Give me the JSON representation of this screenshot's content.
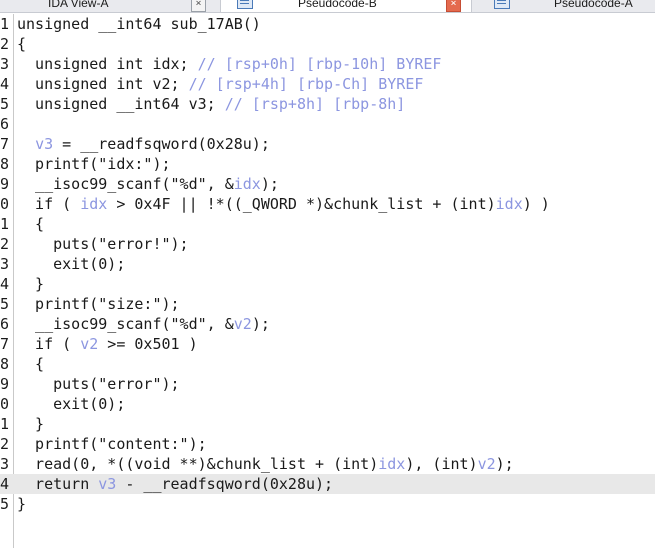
{
  "tabs": [
    {
      "label": "IDA View-A",
      "close": "×"
    },
    {
      "label": "Pseudocode-B",
      "close": "×"
    },
    {
      "label": "Pseudocode-A"
    }
  ],
  "code": [
    {
      "n": "1",
      "parts": [
        [
          "def",
          "unsigned __int64 sub_17AB()"
        ]
      ]
    },
    {
      "n": "2",
      "parts": [
        [
          "def",
          "{"
        ]
      ]
    },
    {
      "n": "3",
      "parts": [
        [
          "def",
          "  unsigned int idx; "
        ],
        [
          "cmt",
          "// [rsp+0h] [rbp-10h] BYREF"
        ]
      ]
    },
    {
      "n": "4",
      "parts": [
        [
          "def",
          "  unsigned int v2; "
        ],
        [
          "cmt",
          "// [rsp+4h] [rbp-Ch] BYREF"
        ]
      ]
    },
    {
      "n": "5",
      "parts": [
        [
          "def",
          "  unsigned __int64 v3; "
        ],
        [
          "cmt",
          "// [rsp+8h] [rbp-8h]"
        ]
      ]
    },
    {
      "n": "6",
      "parts": []
    },
    {
      "n": "7",
      "parts": [
        [
          "def",
          "  "
        ],
        [
          "var",
          "v3"
        ],
        [
          "def",
          " = __readfsqword(0x28u);"
        ]
      ]
    },
    {
      "n": "8",
      "parts": [
        [
          "def",
          "  printf(\"idx:\");"
        ]
      ]
    },
    {
      "n": "9",
      "parts": [
        [
          "def",
          "  __isoc99_scanf(\"%d\", &"
        ],
        [
          "var",
          "idx"
        ],
        [
          "def",
          ");"
        ]
      ]
    },
    {
      "n": "0",
      "parts": [
        [
          "def",
          "  if ( "
        ],
        [
          "var",
          "idx"
        ],
        [
          "def",
          " > 0x4F || !*((_QWORD *)&chunk_list + (int)"
        ],
        [
          "var",
          "idx"
        ],
        [
          "def",
          ") )"
        ]
      ]
    },
    {
      "n": "1",
      "parts": [
        [
          "def",
          "  {"
        ]
      ]
    },
    {
      "n": "2",
      "parts": [
        [
          "def",
          "    puts(\"error!\");"
        ]
      ]
    },
    {
      "n": "3",
      "parts": [
        [
          "def",
          "    exit(0);"
        ]
      ]
    },
    {
      "n": "4",
      "parts": [
        [
          "def",
          "  }"
        ]
      ]
    },
    {
      "n": "5",
      "parts": [
        [
          "def",
          "  printf(\"size:\");"
        ]
      ]
    },
    {
      "n": "6",
      "parts": [
        [
          "def",
          "  __isoc99_scanf(\"%d\", &"
        ],
        [
          "var",
          "v2"
        ],
        [
          "def",
          ");"
        ]
      ]
    },
    {
      "n": "7",
      "parts": [
        [
          "def",
          "  if ( "
        ],
        [
          "var",
          "v2"
        ],
        [
          "def",
          " >= 0x501 )"
        ]
      ]
    },
    {
      "n": "8",
      "parts": [
        [
          "def",
          "  {"
        ]
      ]
    },
    {
      "n": "9",
      "parts": [
        [
          "def",
          "    puts(\"error\");"
        ]
      ]
    },
    {
      "n": "0",
      "parts": [
        [
          "def",
          "    exit(0);"
        ]
      ]
    },
    {
      "n": "1",
      "parts": [
        [
          "def",
          "  }"
        ]
      ]
    },
    {
      "n": "2",
      "parts": [
        [
          "def",
          "  printf(\"content:\");"
        ]
      ]
    },
    {
      "n": "3",
      "parts": [
        [
          "def",
          "  read(0, *((void **)&chunk_list + (int)"
        ],
        [
          "var",
          "idx"
        ],
        [
          "def",
          "), (int)"
        ],
        [
          "var",
          "v2"
        ],
        [
          "def",
          ");"
        ]
      ]
    },
    {
      "n": "4",
      "parts": [
        [
          "def",
          "  return "
        ],
        [
          "var",
          "v3"
        ],
        [
          "def",
          " - __readfsqword(0x28u);"
        ]
      ],
      "highlight": true
    },
    {
      "n": "5",
      "parts": [
        [
          "def",
          "}"
        ]
      ]
    }
  ]
}
